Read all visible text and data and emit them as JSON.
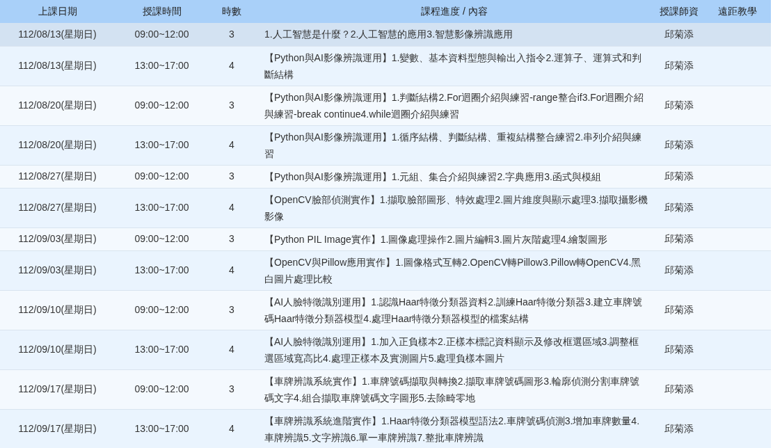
{
  "columns": [
    "上課日期",
    "授課時間",
    "時數",
    "課程進度 / 內容",
    "授課師資",
    "遠距教學"
  ],
  "rows": [
    {
      "date": "112/08/13(星期日)",
      "time": "09:00~12:00",
      "hours": "3",
      "content": "1.人工智慧是什麼？2.人工智慧的應用3.智慧影像辨識應用",
      "teacher": "邱菊添",
      "selected": true
    },
    {
      "date": "112/08/13(星期日)",
      "time": "13:00~17:00",
      "hours": "4",
      "content": "【Python與AI影像辨識運用】1.變數、基本資料型態與輸出入指令2.運算子、運算式和判斷結構",
      "teacher": "邱菊添",
      "selected": false
    },
    {
      "date": "112/08/20(星期日)",
      "time": "09:00~12:00",
      "hours": "3",
      "content": "【Python與AI影像辨識運用】1.判斷結構2.For迴圈介紹與練習-range整合if3.For迴圈介紹與練習-break continue4.while迴圈介紹與練習",
      "teacher": "邱菊添",
      "selected": false
    },
    {
      "date": "112/08/20(星期日)",
      "time": "13:00~17:00",
      "hours": "4",
      "content": "【Python與AI影像辨識運用】1.循序結構、判斷結構、重複結構整合練習2.串列介紹與練習",
      "teacher": "邱菊添",
      "selected": false
    },
    {
      "date": "112/08/27(星期日)",
      "time": "09:00~12:00",
      "hours": "3",
      "content": "【Python與AI影像辨識運用】1.元組、集合介紹與練習2.字典應用3.函式與模組",
      "teacher": "邱菊添",
      "selected": false
    },
    {
      "date": "112/08/27(星期日)",
      "time": "13:00~17:00",
      "hours": "4",
      "content": "【OpenCV臉部偵測實作】1.擷取臉部圖形、特效處理2.圖片維度與顯示處理3.擷取攝影機影像",
      "teacher": "邱菊添",
      "selected": false
    },
    {
      "date": "112/09/03(星期日)",
      "time": "09:00~12:00",
      "hours": "3",
      "content": "【Python PIL Image實作】1.圖像處理操作2.圖片編輯3.圖片灰階處理4.繪製圖形",
      "teacher": "邱菊添",
      "selected": false
    },
    {
      "date": "112/09/03(星期日)",
      "time": "13:00~17:00",
      "hours": "4",
      "content": "【OpenCV與Pillow應用實作】1.圖像格式互轉2.OpenCV轉Pillow3.Pillow轉OpenCV4.黑白圖片處理比較",
      "teacher": "邱菊添",
      "selected": false
    },
    {
      "date": "112/09/10(星期日)",
      "time": "09:00~12:00",
      "hours": "3",
      "content": "【AI人臉特徵識別運用】1.認識Haar特徵分類器資料2.訓練Haar特徵分類器3.建立車牌號碼Haar特徵分類器模型4.處理Haar特徵分類器模型的檔案結構",
      "teacher": "邱菊添",
      "selected": false
    },
    {
      "date": "112/09/10(星期日)",
      "time": "13:00~17:00",
      "hours": "4",
      "content": "【AI人臉特徵識別運用】1.加入正負樣本2.正樣本標記資料顯示及修改框選區域3.調整框選區域寬高比4.處理正樣本及實測圖片5.處理負樣本圖片",
      "teacher": "邱菊添",
      "selected": false
    },
    {
      "date": "112/09/17(星期日)",
      "time": "09:00~12:00",
      "hours": "3",
      "content": "【車牌辨識系統實作】1.車牌號碼擷取與轉換2.擷取車牌號碼圖形3.輪廓偵測分割車牌號碼文字4.組合擷取車牌號碼文字圖形5.去除畸零地",
      "teacher": "邱菊添",
      "selected": false
    },
    {
      "date": "112/09/17(星期日)",
      "time": "13:00~17:00",
      "hours": "4",
      "content": "【車牌辨識系統進階實作】1.Haar特徵分類器模型語法2.車牌號碼偵測3.增加車牌數量4.車牌辨識5.文字辨識6.單一車牌辨識7.整批車牌辨識",
      "teacher": "邱菊添",
      "selected": false
    }
  ]
}
